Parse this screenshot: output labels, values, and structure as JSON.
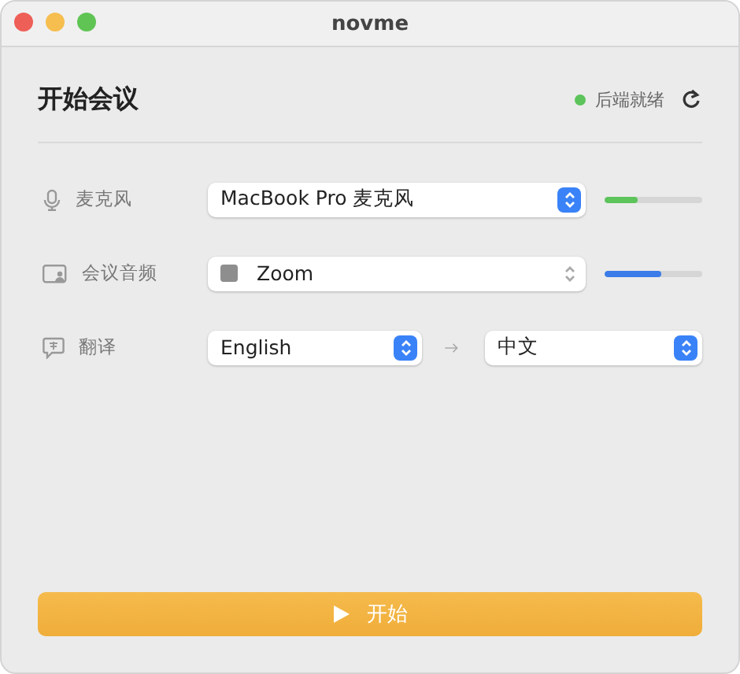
{
  "window": {
    "title": "novme"
  },
  "heading": "开始会议",
  "status": {
    "text": "后端就绪",
    "color": "#5cc45a"
  },
  "rows": [
    {
      "kind": "device",
      "label": "麦克风",
      "value": "MacBook Pro 麦克风",
      "swatch": false,
      "accent": true,
      "level": 0.34,
      "color": "#5cc45a"
    },
    {
      "kind": "device",
      "label": "会议音频",
      "value": "Zoom",
      "swatch": true,
      "accent": false,
      "level": 0.58,
      "color": "#3b7ce8"
    },
    {
      "kind": "translate",
      "label": "翻译",
      "source": "English",
      "target": "中文"
    }
  ],
  "start_button": "开始"
}
